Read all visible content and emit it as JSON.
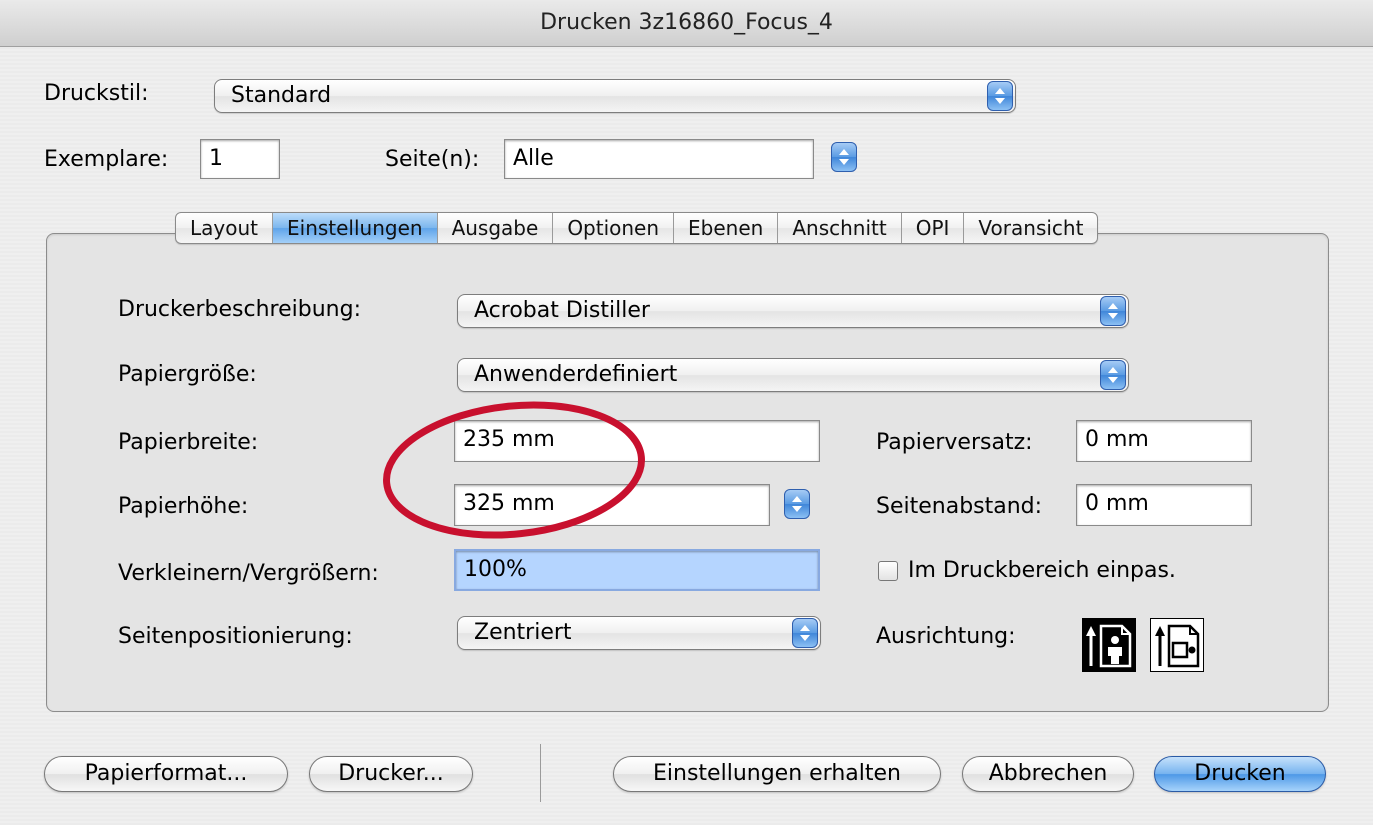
{
  "window": {
    "title": "Drucken 3z16860_Focus_4"
  },
  "top": {
    "druckstil_label": "Druckstil:",
    "druckstil_value": "Standard",
    "exemplare_label": "Exemplare:",
    "exemplare_value": "1",
    "seiten_label": "Seite(n):",
    "seiten_value": "Alle"
  },
  "tabs": [
    {
      "label": "Layout"
    },
    {
      "label": "Einstellungen",
      "selected": true
    },
    {
      "label": "Ausgabe"
    },
    {
      "label": "Optionen"
    },
    {
      "label": "Ebenen"
    },
    {
      "label": "Anschnitt"
    },
    {
      "label": "OPI"
    },
    {
      "label": "Voransicht"
    }
  ],
  "settings": {
    "druckerbeschreibung_label": "Druckerbeschreibung:",
    "druckerbeschreibung_value": "Acrobat Distiller",
    "papiergroesse_label": "Papiergröße:",
    "papiergroesse_value": "Anwenderdefiniert",
    "papierbreite_label": "Papierbreite:",
    "papierbreite_value": "235 mm",
    "papierhoehe_label": "Papierhöhe:",
    "papierhoehe_value": "325 mm",
    "papierversatz_label": "Papierversatz:",
    "papierversatz_value": "0 mm",
    "seitenabstand_label": "Seitenabstand:",
    "seitenabstand_value": "0 mm",
    "skalierung_label": "Verkleinern/Vergrößern:",
    "skalierung_value": "100%",
    "einpassen_label": "Im Druckbereich einpas.",
    "einpassen_checked": false,
    "seitenpositionierung_label": "Seitenpositionierung:",
    "seitenpositionierung_value": "Zentriert",
    "ausrichtung_label": "Ausrichtung:",
    "ausrichtung_selected": "portrait"
  },
  "buttons": {
    "papierformat": "Papierformat...",
    "drucker": "Drucker...",
    "einstellungen_erhalten": "Einstellungen erhalten",
    "abbrechen": "Abbrechen",
    "drucken": "Drucken"
  },
  "annotation": {
    "color": "#c8102e",
    "shape": "ellipse"
  }
}
